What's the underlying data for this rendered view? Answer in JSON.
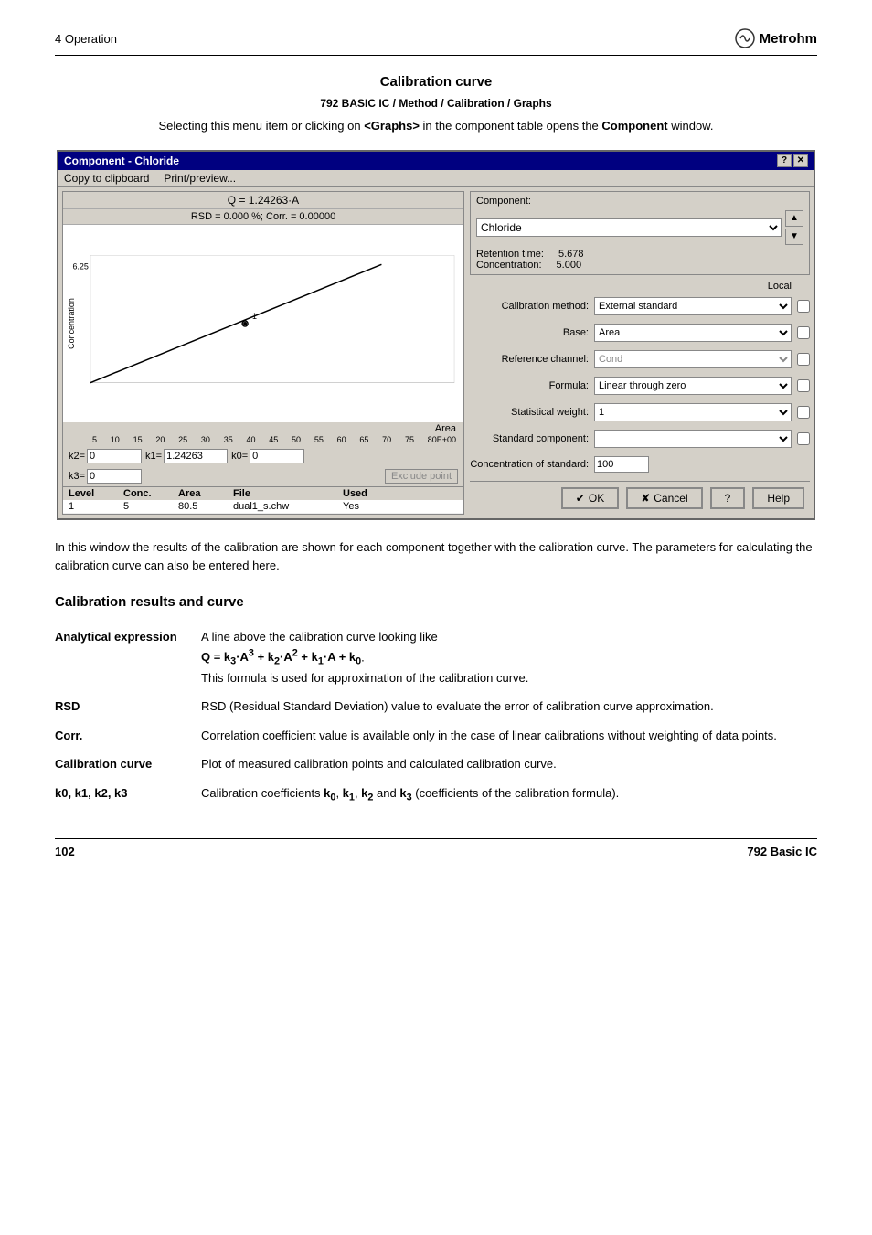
{
  "header": {
    "left": "4   Operation",
    "logo_text": "Metrohm"
  },
  "section1": {
    "title": "Calibration curve",
    "breadcrumb": "792 BASIC IC / Method / Calibration / Graphs",
    "intro": "Selecting this menu item or clicking on <Graphs> in the component table opens the Component window."
  },
  "dialog": {
    "title": "Component - Chloride",
    "menu": [
      "Copy to clipboard",
      "Print/preview..."
    ],
    "equation1": "Q = 1.24263·A",
    "equation2": "RSD = 0.000 %;  Corr. = 0.00000",
    "graph": {
      "y_label": "Concentration",
      "y_value": "6.25",
      "x_label": "Area",
      "x_axis": "5  10  15  20  25  30  35  40  45  50  55  60  65  70  75  80E+00"
    },
    "k_values": {
      "k2_label": "k2=",
      "k2_value": "0",
      "k1_label": "k1=",
      "k1_value": "1.24263",
      "k0_label": "k0=",
      "k0_value": "0",
      "k3_label": "k3=",
      "k3_value": "0",
      "exclude_btn": "Exclude point"
    },
    "table": {
      "headers": [
        "Level",
        "Conc.",
        "Area",
        "File",
        "Used"
      ],
      "rows": [
        [
          "1",
          "5",
          "80.5",
          "dual1_s.chw",
          "Yes"
        ]
      ]
    },
    "right_panel": {
      "component_label": "Component:",
      "component_value": "Chloride",
      "retention_label": "Retention time:",
      "retention_value": "5.678",
      "concentration_label": "Concentration:",
      "concentration_value": "5.000",
      "local_label": "Local",
      "calibration_method_label": "Calibration method:",
      "calibration_method_value": "External standard",
      "base_label": "Base:",
      "base_value": "Area",
      "reference_channel_label": "Reference channel:",
      "reference_channel_value": "Cond",
      "formula_label": "Formula:",
      "formula_value": "Linear through zero",
      "statistical_weight_label": "Statistical weight:",
      "statistical_weight_value": "1",
      "standard_component_label": "Standard component:",
      "standard_component_value": "",
      "concentration_of_standard_label": "Concentration of standard:",
      "concentration_of_standard_value": "100"
    },
    "footer_buttons": {
      "ok": "OK",
      "cancel": "Cancel",
      "help": "Help"
    }
  },
  "desc_text": "In this window the results of the calibration are shown for each component together with the calibration curve. The parameters for calculating the calibration curve can also be entered here.",
  "results_section": {
    "title": "Calibration results and curve",
    "rows": [
      {
        "term": "Analytical expression",
        "definition": "A line above the calibration curve looking like Q = k₃·A³ + k₂·A² + k₁·A + k₀. This formula is used for approximation of the calibration curve."
      },
      {
        "term": "RSD",
        "definition": "RSD (Residual Standard Deviation) value to evaluate the error of calibration curve approximation."
      },
      {
        "term": "Corr.",
        "definition": "Correlation coefficient value is available only in the case of linear calibrations without weighting of data points."
      },
      {
        "term": "Calibration curve",
        "definition": "Plot of measured calibration points and calculated calibration curve."
      },
      {
        "term": "k0, k1, k2, k3",
        "definition": "Calibration coefficients k₀, k₁, k₂ and k₃ (coefficients of the calibration formula)."
      }
    ]
  },
  "footer": {
    "left": "102",
    "right": "792 Basic IC"
  }
}
